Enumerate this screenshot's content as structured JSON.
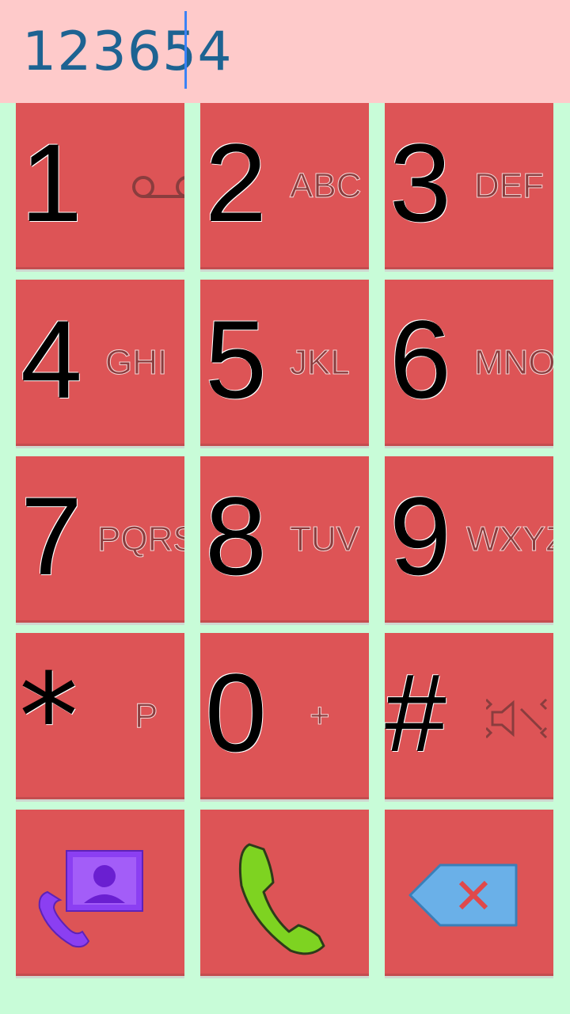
{
  "display": {
    "number": "123654"
  },
  "keypad": {
    "keys": [
      {
        "digit": "1",
        "sub": ""
      },
      {
        "digit": "2",
        "sub": "ABC"
      },
      {
        "digit": "3",
        "sub": "DEF"
      },
      {
        "digit": "4",
        "sub": "GHI"
      },
      {
        "digit": "5",
        "sub": "JKL"
      },
      {
        "digit": "6",
        "sub": "MNO"
      },
      {
        "digit": "7",
        "sub": "PQRS"
      },
      {
        "digit": "8",
        "sub": "TUV"
      },
      {
        "digit": "9",
        "sub": "WXYZ"
      },
      {
        "digit": "*",
        "sub": "P"
      },
      {
        "digit": "0",
        "sub": "+"
      },
      {
        "digit": "#",
        "sub": ""
      }
    ],
    "icons": {
      "key1": "voicemail-icon",
      "keyhash": "mute-icon",
      "contacts": "contacts-call-icon",
      "call": "phone-call-icon",
      "delete": "backspace-icon"
    }
  },
  "colors": {
    "background": "#c8fcd8",
    "display_bg": "#fecaca",
    "display_text": "#1d6392",
    "key_bg": "#dd5456",
    "call_green": "#7ed321",
    "contacts_purple": "#8b3ff2",
    "delete_blue": "#6ab0e8"
  }
}
